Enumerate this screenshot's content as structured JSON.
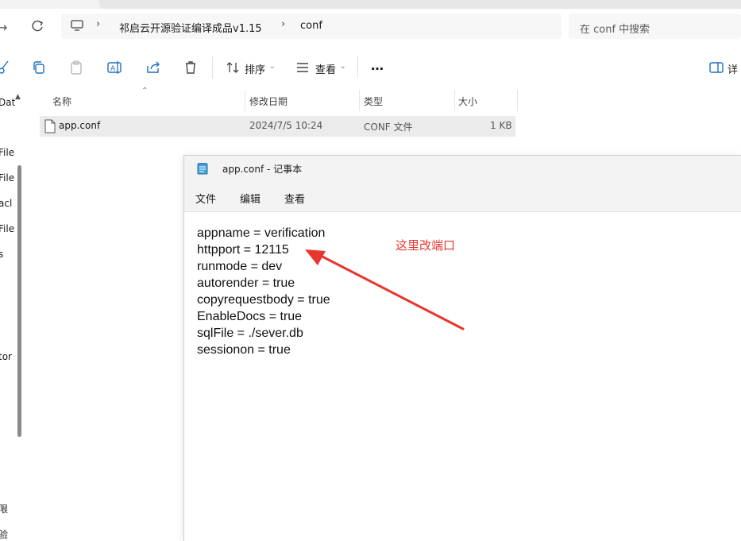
{
  "explorer": {
    "breadcrumb": [
      "祁启云开源验证编译成品v1.15",
      "conf"
    ],
    "search_placeholder": "在 conf 中搜索",
    "toolbar": {
      "sort_label": "排序",
      "view_label": "查看",
      "more_label": "…",
      "details_label": "详"
    },
    "sidebar_items": [
      "Dat",
      "File",
      "File",
      "acl",
      "File",
      "s",
      "tor",
      "限",
      "验"
    ],
    "columns": [
      "名称",
      "修改日期",
      "类型",
      "大小"
    ],
    "files": [
      {
        "name": "app.conf",
        "modified": "2024/7/5 10:24",
        "type": "CONF 文件",
        "size": "1 KB"
      }
    ]
  },
  "notepad": {
    "title": "app.conf - 记事本",
    "menu": [
      "文件",
      "编辑",
      "查看"
    ],
    "lines": [
      "appname = verification",
      "httpport = 12115",
      "runmode = dev",
      "autorender = true",
      "copyrequestbody = true",
      "EnableDocs = true",
      "sqlFile = ./sever.db",
      "sessionon = true"
    ]
  },
  "annotation": {
    "text": "这里改端口",
    "color": "#e8352e"
  }
}
